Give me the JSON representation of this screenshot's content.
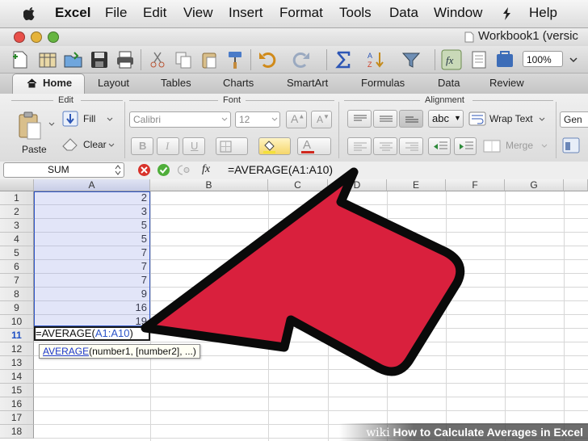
{
  "menu": {
    "app_name": "Excel",
    "items": [
      "File",
      "Edit",
      "View",
      "Insert",
      "Format",
      "Tools",
      "Data",
      "Window",
      "Help"
    ]
  },
  "window": {
    "title": "Workbook1 (versic"
  },
  "toolbar": {
    "zoom": "100%"
  },
  "ribbon_tabs": [
    "Home",
    "Layout",
    "Tables",
    "Charts",
    "SmartArt",
    "Formulas",
    "Data",
    "Review"
  ],
  "ribbon": {
    "edit_group": "Edit",
    "font_group": "Font",
    "alignment_group": "Alignment",
    "paste_label": "Paste",
    "fill_label": "Fill",
    "clear_label": "Clear",
    "font_name": "Calibri",
    "font_size": "12",
    "wrap_text_label": "Wrap Text",
    "merge_label": "Merge",
    "number_format": "Gen",
    "abc_label": "abc"
  },
  "formula_bar": {
    "name_box": "SUM",
    "fx_label": "fx",
    "formula": "=AVERAGE(A1:A10)"
  },
  "grid": {
    "columns": [
      "A",
      "B",
      "C",
      "D",
      "E",
      "F",
      "G"
    ],
    "rows": [
      "1",
      "2",
      "3",
      "4",
      "5",
      "6",
      "7",
      "8",
      "9",
      "10",
      "11",
      "12",
      "13",
      "14",
      "15",
      "16",
      "17",
      "18"
    ],
    "column_a_values": [
      "2",
      "3",
      "5",
      "5",
      "7",
      "7",
      "7",
      "9",
      "16",
      "19"
    ],
    "editing_cell_text": "=AVERAGE(A1:A10)",
    "tooltip_function": "AVERAGE",
    "tooltip_args": "(number1, [number2], ...)"
  },
  "watermark": {
    "brand": "wiki",
    "text": "How to Calculate Averages in Excel"
  },
  "colors": {
    "arrow_fill": "#d9203d",
    "selection_border": "#2c54c8",
    "active_row_header": "#1d4fc4"
  }
}
